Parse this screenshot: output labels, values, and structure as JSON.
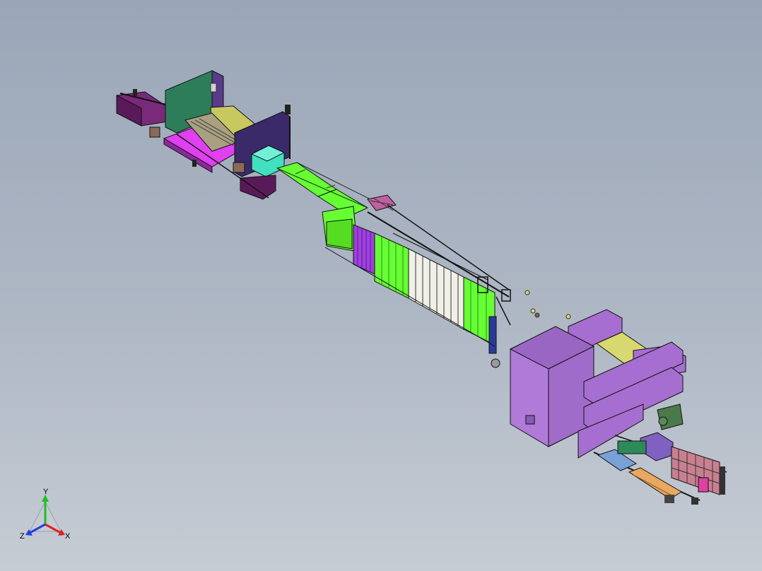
{
  "viewport": {
    "background_top": "#9aa6b8",
    "background_bottom": "#c6ccd4"
  },
  "model": {
    "assemblies": [
      {
        "name": "infeed-station",
        "colors": [
          "#7a2a7a",
          "#e040f0",
          "#2e7d5a",
          "#c8c860",
          "#40e0c0",
          "#3a2a6a"
        ]
      },
      {
        "name": "conveyor-belt",
        "colors": [
          "#66ff33"
        ]
      },
      {
        "name": "roller-rack-station",
        "colors": [
          "#66ff33",
          "#a040e0",
          "#f0f0e8"
        ]
      },
      {
        "name": "press-machine",
        "colors": [
          "#a66ed0",
          "#d8d870",
          "#4a7a4a"
        ]
      },
      {
        "name": "outfeed-station",
        "colors": [
          "#e8a860",
          "#8060c0",
          "#e040a0"
        ]
      }
    ]
  },
  "triad": {
    "x_label": "X",
    "y_label": "Y",
    "z_label": "Z",
    "x_color": "#e02020",
    "y_color": "#20c020",
    "z_color": "#2040e0"
  }
}
